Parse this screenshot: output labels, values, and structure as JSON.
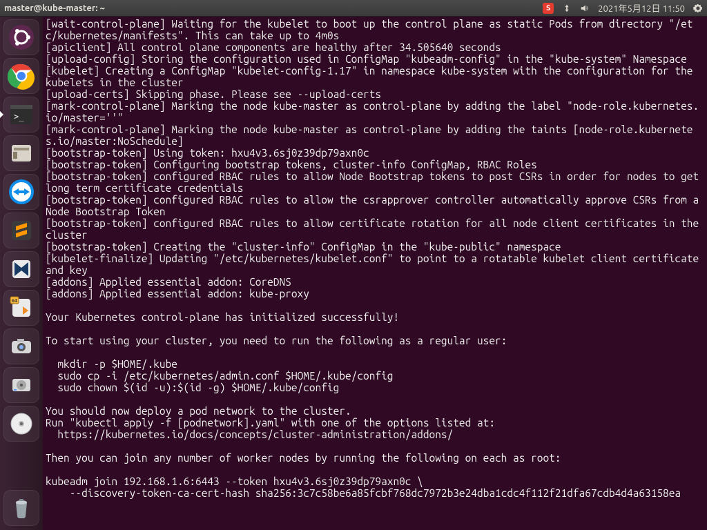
{
  "topbar": {
    "title": "master@kube-master: ~",
    "ime_badge": "S",
    "datetime": "2021年5月12日 11:50"
  },
  "launcher": {
    "items": [
      {
        "name": "ubuntu-dash",
        "title": "Dash"
      },
      {
        "name": "chrome",
        "title": "Google Chrome"
      },
      {
        "name": "terminal",
        "title": "Terminal",
        "active": true
      },
      {
        "name": "files",
        "title": "Files"
      },
      {
        "name": "teamviewer",
        "title": "TeamViewer"
      },
      {
        "name": "sublime",
        "title": "Sublime Text"
      },
      {
        "name": "virtualbox",
        "title": "VirtualBox"
      },
      {
        "name": "virtualbox-vm",
        "title": "VM"
      },
      {
        "name": "camera",
        "title": "Shotwell"
      },
      {
        "name": "disks",
        "title": "Disks"
      },
      {
        "name": "disc",
        "title": "Brasero"
      }
    ],
    "trash": "Trash"
  },
  "terminal": {
    "lines": [
      "[wait-control-plane] Waiting for the kubelet to boot up the control plane as static Pods from directory \"/etc/kubernetes/manifests\". This can take up to 4m0s",
      "[apiclient] All control plane components are healthy after 34.505640 seconds",
      "[upload-config] Storing the configuration used in ConfigMap \"kubeadm-config\" in the \"kube-system\" Namespace",
      "[kubelet] Creating a ConfigMap \"kubelet-config-1.17\" in namespace kube-system with the configuration for the kubelets in the cluster",
      "[upload-certs] Skipping phase. Please see --upload-certs",
      "[mark-control-plane] Marking the node kube-master as control-plane by adding the label \"node-role.kubernetes.io/master=''\"",
      "[mark-control-plane] Marking the node kube-master as control-plane by adding the taints [node-role.kubernetes.io/master:NoSchedule]",
      "[bootstrap-token] Using token: hxu4v3.6sj0z39dp79axn0c",
      "[bootstrap-token] Configuring bootstrap tokens, cluster-info ConfigMap, RBAC Roles",
      "[bootstrap-token] configured RBAC rules to allow Node Bootstrap tokens to post CSRs in order for nodes to get long term certificate credentials",
      "[bootstrap-token] configured RBAC rules to allow the csrapprover controller automatically approve CSRs from a Node Bootstrap Token",
      "[bootstrap-token] configured RBAC rules to allow certificate rotation for all node client certificates in the cluster",
      "[bootstrap-token] Creating the \"cluster-info\" ConfigMap in the \"kube-public\" namespace",
      "[kubelet-finalize] Updating \"/etc/kubernetes/kubelet.conf\" to point to a rotatable kubelet client certificate and key",
      "[addons] Applied essential addon: CoreDNS",
      "[addons] Applied essential addon: kube-proxy",
      "",
      "Your Kubernetes control-plane has initialized successfully!",
      "",
      "To start using your cluster, you need to run the following as a regular user:",
      "",
      "  mkdir -p $HOME/.kube",
      "  sudo cp -i /etc/kubernetes/admin.conf $HOME/.kube/config",
      "  sudo chown $(id -u):$(id -g) $HOME/.kube/config",
      "",
      "You should now deploy a pod network to the cluster.",
      "Run \"kubectl apply -f [podnetwork].yaml\" with one of the options listed at:",
      "  https://kubernetes.io/docs/concepts/cluster-administration/addons/",
      "",
      "Then you can join any number of worker nodes by running the following on each as root:",
      "",
      "kubeadm join 192.168.1.6:6443 --token hxu4v3.6sj0z39dp79axn0c \\",
      "    --discovery-token-ca-cert-hash sha256:3c7c58be6a85fcbf768dc7972b3e24dba1cdc4f112f21dfa67cdb4d4a63158ea"
    ]
  }
}
